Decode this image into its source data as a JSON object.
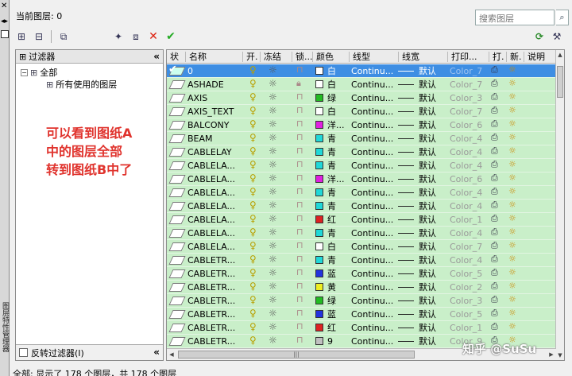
{
  "sidebar_strip": {
    "close": "✕",
    "arrows": "◂▸",
    "title": "图层特性管理器"
  },
  "current_layer": "当前图层: 0",
  "search": {
    "placeholder": "搜索图层",
    "icon": "search-icon"
  },
  "toolbar": {
    "new_property_filter": "new-property-filter-icon",
    "new_group_filter": "new-group-filter-icon",
    "layer_states": "layer-states-icon",
    "new_layer": "new-layer-icon",
    "new_layer_frozen": "new-layer-vp-frozen-icon",
    "delete": "✕",
    "set_current": "✔",
    "refresh": "⟳",
    "settings": "wrench-icon"
  },
  "filter_panel": {
    "header": "过滤器",
    "collapse": "«",
    "tree": [
      {
        "label": "全部"
      },
      {
        "label": "所有使用的图层"
      }
    ],
    "invert_label": "反转过滤器(I)"
  },
  "annotation": [
    "可以看到图纸A",
    "中的图层全部",
    "转到图纸B中了"
  ],
  "columns": [
    "状",
    "名称",
    "开.",
    "冻结",
    "锁...",
    "颜色",
    "线型",
    "线宽",
    "打印...",
    "打.",
    "新.",
    "说明"
  ],
  "layers": [
    {
      "name": "0",
      "color": "白",
      "swatch": "#ffffff",
      "linetype": "Continu...",
      "lineweight": "默认",
      "plot_style": "Color_7",
      "current": true,
      "locked": false
    },
    {
      "name": "ASHADE",
      "color": "白",
      "swatch": "#ffffff",
      "linetype": "Continu...",
      "lineweight": "默认",
      "plot_style": "Color_7",
      "locked": true
    },
    {
      "name": "AXIS",
      "color": "绿",
      "swatch": "#22bb22",
      "linetype": "Continu...",
      "lineweight": "默认",
      "plot_style": "Color_3"
    },
    {
      "name": "AXIS_TEXT",
      "color": "白",
      "swatch": "#ffffff",
      "linetype": "Continu...",
      "lineweight": "默认",
      "plot_style": "Color_7"
    },
    {
      "name": "BALCONY",
      "color": "洋...",
      "swatch": "#e020e0",
      "linetype": "Continu...",
      "lineweight": "默认",
      "plot_style": "Color_6"
    },
    {
      "name": "BEAM",
      "color": "青",
      "swatch": "#20d8d8",
      "linetype": "Continu...",
      "lineweight": "默认",
      "plot_style": "Color_4"
    },
    {
      "name": "CABLELAY",
      "color": "青",
      "swatch": "#20d8d8",
      "linetype": "Continu...",
      "lineweight": "默认",
      "plot_style": "Color_4"
    },
    {
      "name": "CABLELA...",
      "color": "青",
      "swatch": "#20d8d8",
      "linetype": "Continu...",
      "lineweight": "默认",
      "plot_style": "Color_4"
    },
    {
      "name": "CABLELA...",
      "color": "洋...",
      "swatch": "#e020e0",
      "linetype": "Continu...",
      "lineweight": "默认",
      "plot_style": "Color_6"
    },
    {
      "name": "CABLELA...",
      "color": "青",
      "swatch": "#20d8d8",
      "linetype": "Continu...",
      "lineweight": "默认",
      "plot_style": "Color_4"
    },
    {
      "name": "CABLELA...",
      "color": "青",
      "swatch": "#20d8d8",
      "linetype": "Continu...",
      "lineweight": "默认",
      "plot_style": "Color_4"
    },
    {
      "name": "CABLELA...",
      "color": "红",
      "swatch": "#dd2222",
      "linetype": "Continu...",
      "lineweight": "默认",
      "plot_style": "Color_1"
    },
    {
      "name": "CABLELA...",
      "color": "青",
      "swatch": "#20d8d8",
      "linetype": "Continu...",
      "lineweight": "默认",
      "plot_style": "Color_4"
    },
    {
      "name": "CABLELA...",
      "color": "白",
      "swatch": "#ffffff",
      "linetype": "Continu...",
      "lineweight": "默认",
      "plot_style": "Color_7"
    },
    {
      "name": "CABLETR...",
      "color": "青",
      "swatch": "#20d8d8",
      "linetype": "Continu...",
      "lineweight": "默认",
      "plot_style": "Color_4"
    },
    {
      "name": "CABLETR...",
      "color": "蓝",
      "swatch": "#2233dd",
      "linetype": "Continu...",
      "lineweight": "默认",
      "plot_style": "Color_5"
    },
    {
      "name": "CABLETR...",
      "color": "黄",
      "swatch": "#eeee22",
      "linetype": "Continu...",
      "lineweight": "默认",
      "plot_style": "Color_2"
    },
    {
      "name": "CABLETR...",
      "color": "绿",
      "swatch": "#22bb22",
      "linetype": "Continu...",
      "lineweight": "默认",
      "plot_style": "Color_3"
    },
    {
      "name": "CABLETR...",
      "color": "蓝",
      "swatch": "#2233dd",
      "linetype": "Continu...",
      "lineweight": "默认",
      "plot_style": "Color_5"
    },
    {
      "name": "CABLETR...",
      "color": "红",
      "swatch": "#dd2222",
      "linetype": "Continu...",
      "lineweight": "默认",
      "plot_style": "Color_1"
    },
    {
      "name": "CABLETR...",
      "color": "9",
      "swatch": "#c0c0c0",
      "linetype": "Continu...",
      "lineweight": "默认",
      "plot_style": "Color_9"
    }
  ],
  "watermark": "知乎 @SuSu",
  "status": "全部: 显示了 178 个图层，共 178 个图层",
  "colors": {
    "row_bg": "#c9efc9",
    "selected_row": "#3e8ee3",
    "annotation": "#e0332d"
  }
}
